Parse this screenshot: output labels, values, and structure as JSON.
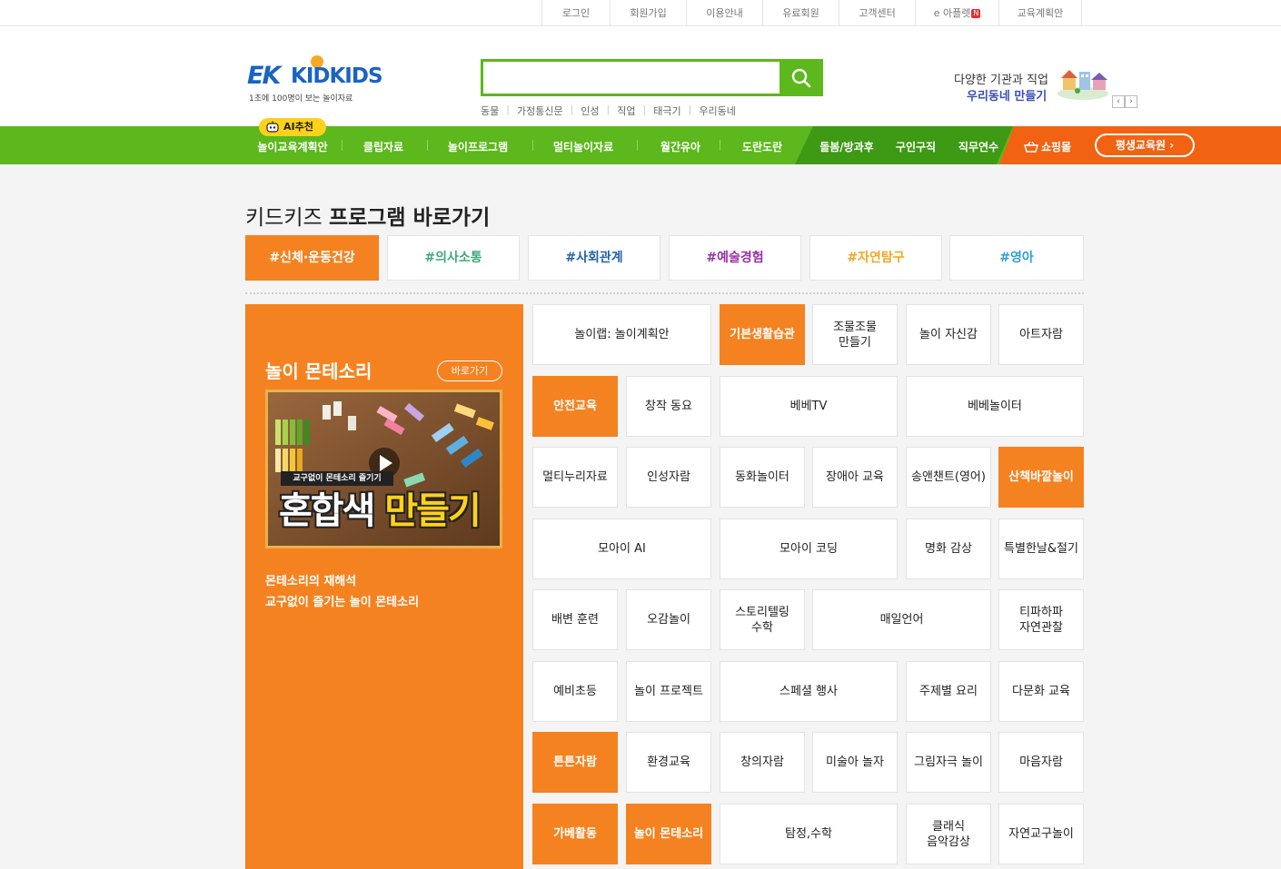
{
  "top_links": [
    {
      "label": "로그인"
    },
    {
      "label": "회원가입"
    },
    {
      "label": "이용안내"
    },
    {
      "label": "유료회원"
    },
    {
      "label": "고객센터"
    },
    {
      "label": "e 아플렛",
      "badge": "N"
    },
    {
      "label": "교육계획안"
    }
  ],
  "logo": {
    "ek": "EK",
    "name": "KIDKIDS",
    "tagline": "1초에 100명이 보는 놀이자료"
  },
  "search": {
    "value": "",
    "placeholder": "",
    "keywords": [
      "동물",
      "가정통신문",
      "인성",
      "직업",
      "태극기",
      "우리동네"
    ]
  },
  "banner": {
    "line1": "다양한 기관과 직업",
    "line2": "우리동네 만들기",
    "prev": "‹",
    "next": "›"
  },
  "nav": {
    "ai_badge": "AI추천",
    "items": [
      "놀이교육계획안",
      "클립자료",
      "놀이프로그램",
      "멀티놀이자료",
      "월간유아",
      "도란도란"
    ],
    "dark_items": [
      "돌봄/방과후",
      "구인구직",
      "직무연수"
    ],
    "shop": "쇼핑몰",
    "edu_button": "평생교육원 ›"
  },
  "section": {
    "title_light": "키드키즈 ",
    "title_bold": "프로그램 바로가기"
  },
  "tabs": [
    {
      "label": "#신체·운동건강",
      "color": "#ffffff",
      "active": true
    },
    {
      "label": "#의사소통",
      "color": "#3fa87a"
    },
    {
      "label": "#사회관계",
      "color": "#2262a8"
    },
    {
      "label": "#예술경험",
      "color": "#9b2fa8"
    },
    {
      "label": "#자연탐구",
      "color": "#f5a623"
    },
    {
      "label": "#영아",
      "color": "#2e9fd8"
    }
  ],
  "feature": {
    "title": "놀이 몬테소리",
    "go_label": "바로가기",
    "thumb_small": "교구없이 몬테소리 즐기기",
    "thumb_big1": "혼합색",
    "thumb_big2": "만들기",
    "desc": [
      "몬테소리의 재해석",
      "교구없이 즐기는 놀이 몬테소리"
    ]
  },
  "programs": [
    {
      "label": "놀이랩: 놀이계획안"
    },
    {
      "label": "기본생활습관",
      "active": true
    },
    {
      "label": "조물조물\n만들기"
    },
    {
      "label": "놀이 자신감"
    },
    {
      "label": "아트자람"
    },
    {
      "label": "안전교육",
      "active": true
    },
    {
      "label": "창작 동요"
    },
    {
      "label": "베베TV"
    },
    {
      "label": "베베놀이터"
    },
    {
      "label": "멀티누리자료"
    },
    {
      "label": "인성자람"
    },
    {
      "label": "동화놀이터"
    },
    {
      "label": "장애아 교육"
    },
    {
      "label": "송앤챈트(영어)"
    },
    {
      "label": "산책바깥놀이",
      "active": true
    },
    {
      "label": "모아이 AI"
    },
    {
      "label": "모아이 코딩"
    },
    {
      "label": "명화 감상"
    },
    {
      "label": "특별한날&절기"
    },
    {
      "label": "배변 훈련"
    },
    {
      "label": "오감놀이"
    },
    {
      "label": "스토리텔링\n수학"
    },
    {
      "label": "매일언어"
    },
    {
      "label": "티파하파\n자연관찰"
    },
    {
      "label": "예비초등"
    },
    {
      "label": "놀이 프로젝트"
    },
    {
      "label": "스페셜 행사"
    },
    {
      "label": "주제별 요리"
    },
    {
      "label": "다문화 교육"
    },
    {
      "label": "튼튼자람",
      "active": true
    },
    {
      "label": "환경교육"
    },
    {
      "label": "창의자람"
    },
    {
      "label": "미술아 놀자"
    },
    {
      "label": "그림자극 놀이"
    },
    {
      "label": "마음자람"
    },
    {
      "label": "가베활동",
      "active": true
    },
    {
      "label": "놀이 몬테소리",
      "active": true
    },
    {
      "label": "탐정,수학"
    },
    {
      "label": "클래식\n음악감상"
    },
    {
      "label": "자연교구놀이"
    }
  ]
}
